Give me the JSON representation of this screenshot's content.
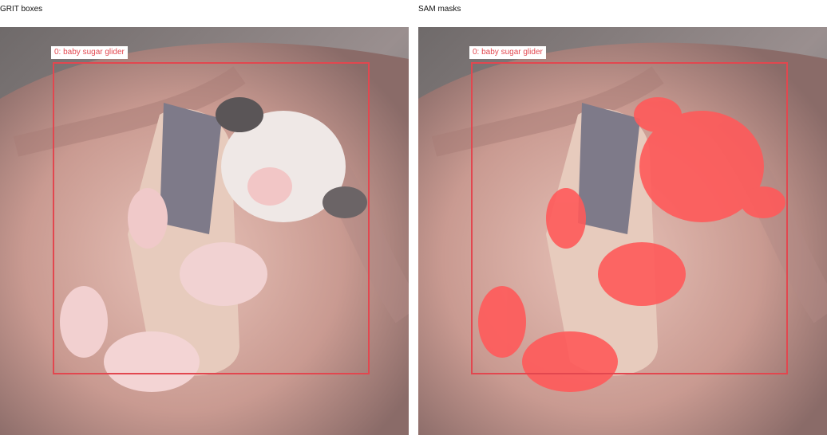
{
  "panels": [
    {
      "title": "GRIT boxes",
      "show_mask": false
    },
    {
      "title": "SAM masks",
      "show_mask": true
    }
  ],
  "detection": {
    "label": "0: baby sugar glider"
  },
  "colors": {
    "box": "#e2474f",
    "mask": "#ff5a5a"
  }
}
